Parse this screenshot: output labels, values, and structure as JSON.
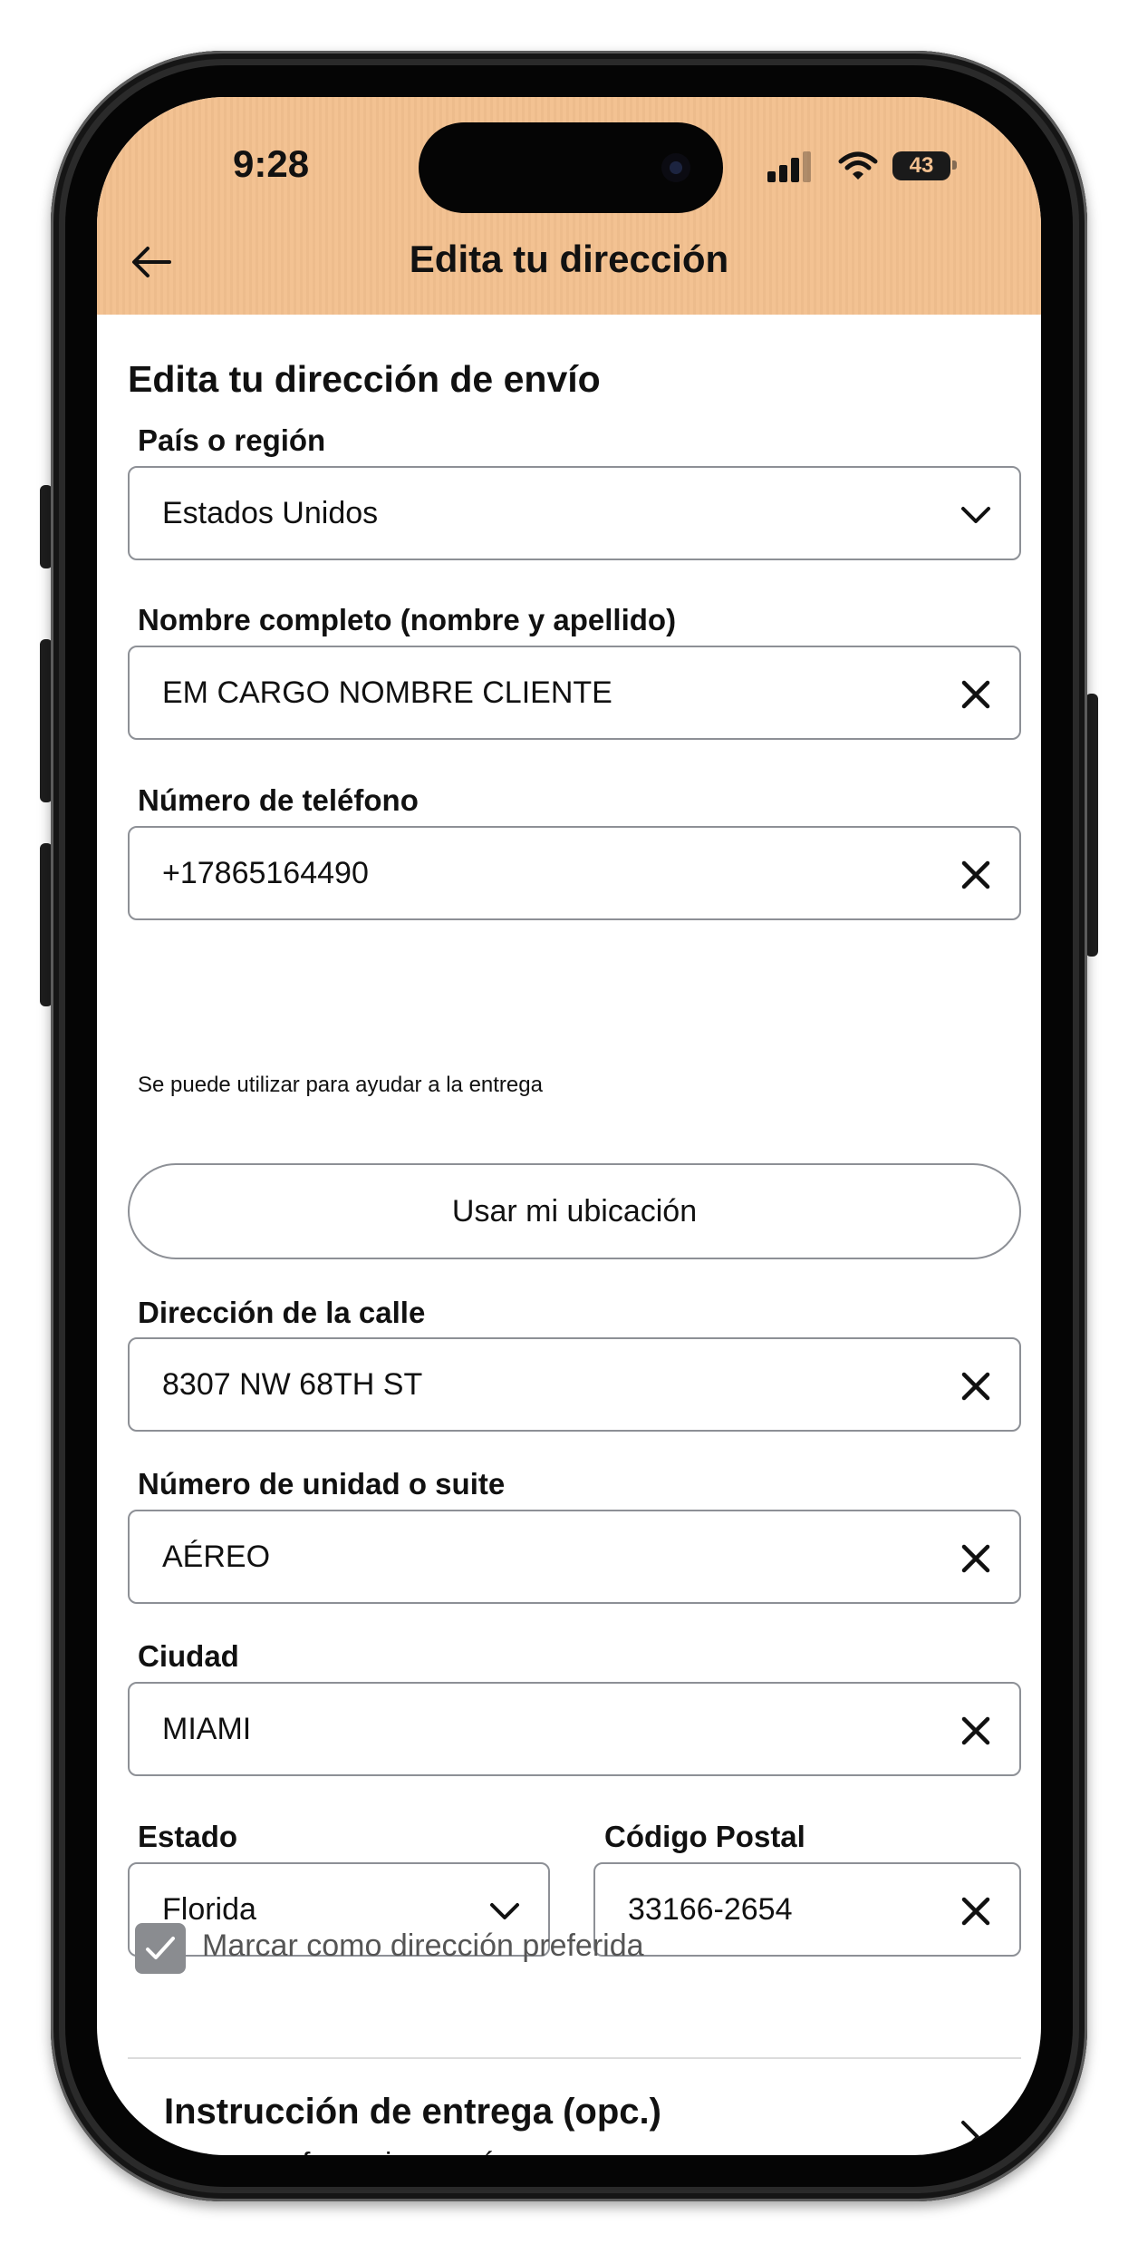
{
  "status_bar": {
    "time": "9:28",
    "battery": "43",
    "icons": [
      "cellular-signal-icon",
      "wifi-icon",
      "battery-icon"
    ]
  },
  "header": {
    "title": "Edita tu dirección",
    "background": "#f3c08f",
    "back_icon": "arrow-left-icon"
  },
  "form": {
    "section_title": "Edita tu dirección de envío",
    "country": {
      "label": "País o región",
      "value": "Estados Unidos",
      "icon": "chevron-down-icon"
    },
    "full_name": {
      "label": "Nombre completo (nombre y apellido)",
      "value": "EM CARGO NOMBRE CLIENTE",
      "icon": "clear-icon"
    },
    "phone": {
      "label": "Número de teléfono",
      "value": "+17865164490",
      "hint": "Se puede utilizar para ayudar a la entrega",
      "icon": "clear-icon"
    },
    "use_location_button": "Usar mi ubicación",
    "street": {
      "label": "Dirección de la calle",
      "value": "8307 NW 68TH ST",
      "icon": "clear-icon"
    },
    "unit": {
      "label": "Número de unidad o suite",
      "value": "AÉREO",
      "icon": "clear-icon"
    },
    "city": {
      "label": "Ciudad",
      "value": "MIAMI",
      "icon": "clear-icon"
    },
    "state": {
      "label": "Estado",
      "value": "Florida",
      "icon": "chevron-down-icon"
    },
    "postal_code": {
      "label": "Código Postal",
      "value": "33166-2654",
      "icon": "clear-icon"
    },
    "preferred": {
      "label": "Marcar como dirección preferida",
      "checked": true
    }
  },
  "delivery_instructions": {
    "title": "Instrucción de entrega (opc.)",
    "subtitle": "Notas, preferencias y más",
    "icon": "chevron-right-icon"
  }
}
